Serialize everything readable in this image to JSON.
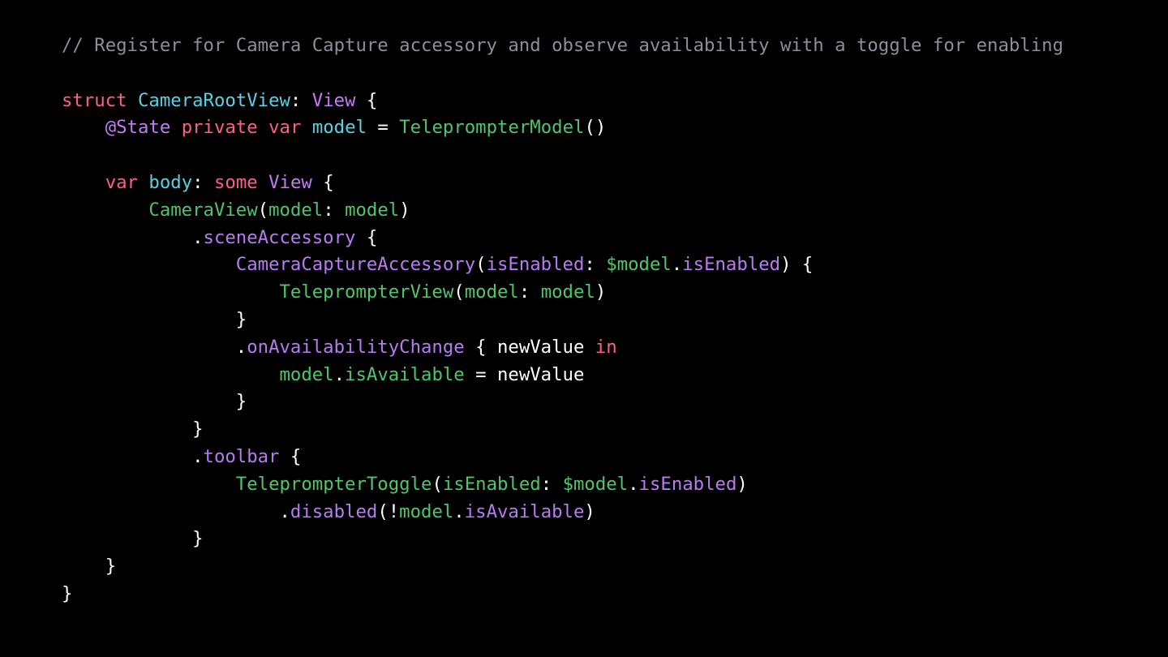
{
  "colors": {
    "background": "#000000",
    "plain": "#FFFFFF",
    "comment": "#8A8F98",
    "keyword": "#FF5E8A",
    "type_decl": "#5AD1E4",
    "type_ref": "#C57BF6",
    "decl": "#5AD1E4",
    "fn": "#4FC66A",
    "member": "#B77CF1",
    "local": "#4FC66A",
    "attribute": "#C57BF6"
  },
  "code": {
    "lines": [
      [
        {
          "t": "// Register for Camera Capture accessory and observe availability with a toggle for enabling",
          "k": "comment"
        }
      ],
      [],
      [
        {
          "t": "struct",
          "k": "keyword"
        },
        {
          "t": " ",
          "k": "plain"
        },
        {
          "t": "CameraRootView",
          "k": "type_decl"
        },
        {
          "t": ": ",
          "k": "plain"
        },
        {
          "t": "View",
          "k": "type_ref"
        },
        {
          "t": " {",
          "k": "plain"
        }
      ],
      [
        {
          "t": "    ",
          "k": "plain"
        },
        {
          "t": "@State",
          "k": "attribute"
        },
        {
          "t": " ",
          "k": "plain"
        },
        {
          "t": "private",
          "k": "keyword"
        },
        {
          "t": " ",
          "k": "plain"
        },
        {
          "t": "var",
          "k": "keyword"
        },
        {
          "t": " ",
          "k": "plain"
        },
        {
          "t": "model",
          "k": "decl"
        },
        {
          "t": " = ",
          "k": "plain"
        },
        {
          "t": "TeleprompterModel",
          "k": "fn"
        },
        {
          "t": "()",
          "k": "plain"
        }
      ],
      [],
      [
        {
          "t": "    ",
          "k": "plain"
        },
        {
          "t": "var",
          "k": "keyword"
        },
        {
          "t": " ",
          "k": "plain"
        },
        {
          "t": "body",
          "k": "decl"
        },
        {
          "t": ": ",
          "k": "plain"
        },
        {
          "t": "some",
          "k": "keyword"
        },
        {
          "t": " ",
          "k": "plain"
        },
        {
          "t": "View",
          "k": "type_ref"
        },
        {
          "t": " {",
          "k": "plain"
        }
      ],
      [
        {
          "t": "        ",
          "k": "plain"
        },
        {
          "t": "CameraView",
          "k": "fn"
        },
        {
          "t": "(",
          "k": "plain"
        },
        {
          "t": "model",
          "k": "fn"
        },
        {
          "t": ": ",
          "k": "plain"
        },
        {
          "t": "model",
          "k": "local"
        },
        {
          "t": ")",
          "k": "plain"
        }
      ],
      [
        {
          "t": "            .",
          "k": "plain"
        },
        {
          "t": "sceneAccessory",
          "k": "member"
        },
        {
          "t": " {",
          "k": "plain"
        }
      ],
      [
        {
          "t": "                ",
          "k": "plain"
        },
        {
          "t": "CameraCaptureAccessory",
          "k": "member"
        },
        {
          "t": "(",
          "k": "plain"
        },
        {
          "t": "isEnabled",
          "k": "member"
        },
        {
          "t": ": ",
          "k": "plain"
        },
        {
          "t": "$model",
          "k": "local"
        },
        {
          "t": ".",
          "k": "plain"
        },
        {
          "t": "isEnabled",
          "k": "member"
        },
        {
          "t": ") {",
          "k": "plain"
        }
      ],
      [
        {
          "t": "                    ",
          "k": "plain"
        },
        {
          "t": "TeleprompterView",
          "k": "fn"
        },
        {
          "t": "(",
          "k": "plain"
        },
        {
          "t": "model",
          "k": "fn"
        },
        {
          "t": ": ",
          "k": "plain"
        },
        {
          "t": "model",
          "k": "local"
        },
        {
          "t": ")",
          "k": "plain"
        }
      ],
      [
        {
          "t": "                }",
          "k": "plain"
        }
      ],
      [
        {
          "t": "                .",
          "k": "plain"
        },
        {
          "t": "onAvailabilityChange",
          "k": "member"
        },
        {
          "t": " { newValue ",
          "k": "plain"
        },
        {
          "t": "in",
          "k": "keyword"
        }
      ],
      [
        {
          "t": "                    ",
          "k": "plain"
        },
        {
          "t": "model",
          "k": "local"
        },
        {
          "t": ".",
          "k": "plain"
        },
        {
          "t": "isAvailable",
          "k": "local"
        },
        {
          "t": " = newValue",
          "k": "plain"
        }
      ],
      [
        {
          "t": "                }",
          "k": "plain"
        }
      ],
      [
        {
          "t": "            }",
          "k": "plain"
        }
      ],
      [
        {
          "t": "            .",
          "k": "plain"
        },
        {
          "t": "toolbar",
          "k": "member"
        },
        {
          "t": " {",
          "k": "plain"
        }
      ],
      [
        {
          "t": "                ",
          "k": "plain"
        },
        {
          "t": "TeleprompterToggle",
          "k": "fn"
        },
        {
          "t": "(",
          "k": "plain"
        },
        {
          "t": "isEnabled",
          "k": "fn"
        },
        {
          "t": ": ",
          "k": "plain"
        },
        {
          "t": "$model",
          "k": "local"
        },
        {
          "t": ".",
          "k": "plain"
        },
        {
          "t": "isEnabled",
          "k": "member"
        },
        {
          "t": ")",
          "k": "plain"
        }
      ],
      [
        {
          "t": "                    .",
          "k": "plain"
        },
        {
          "t": "disabled",
          "k": "member"
        },
        {
          "t": "(!",
          "k": "plain"
        },
        {
          "t": "model",
          "k": "local"
        },
        {
          "t": ".",
          "k": "plain"
        },
        {
          "t": "isAvailable",
          "k": "member"
        },
        {
          "t": ")",
          "k": "plain"
        }
      ],
      [
        {
          "t": "            }",
          "k": "plain"
        }
      ],
      [
        {
          "t": "    }",
          "k": "plain"
        }
      ],
      [
        {
          "t": "}",
          "k": "plain"
        }
      ]
    ]
  }
}
